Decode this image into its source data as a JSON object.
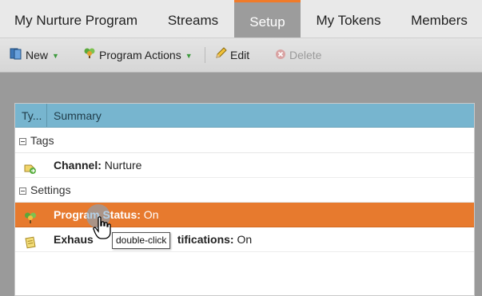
{
  "tabs": [
    {
      "label": "My Nurture Program",
      "active": false
    },
    {
      "label": "Streams",
      "active": false
    },
    {
      "label": "Setup",
      "active": true
    },
    {
      "label": "My Tokens",
      "active": false
    },
    {
      "label": "Members",
      "active": false
    }
  ],
  "toolbar": {
    "new_label": "New",
    "program_actions_label": "Program Actions",
    "edit_label": "Edit",
    "delete_label": "Delete"
  },
  "grid": {
    "col_type": "Ty...",
    "col_summary": "Summary",
    "groups": [
      {
        "label": "Tags"
      },
      {
        "label": "Settings"
      }
    ],
    "rows": [
      {
        "key": "Channel:",
        "value": " Nurture",
        "icon": "channel-icon"
      },
      {
        "key": "Program Status:",
        "value": " On",
        "icon": "program-icon",
        "selected": true
      },
      {
        "key_visible_start": "Exhaus",
        "key_visible_end": "tifications:",
        "value": " On",
        "icon": "notification-icon"
      }
    ]
  },
  "tooltip": "double-click",
  "colors": {
    "active_tab_border": "#f07b2a",
    "selected_row": "#e77a2e",
    "grid_header": "#77b5cf"
  }
}
